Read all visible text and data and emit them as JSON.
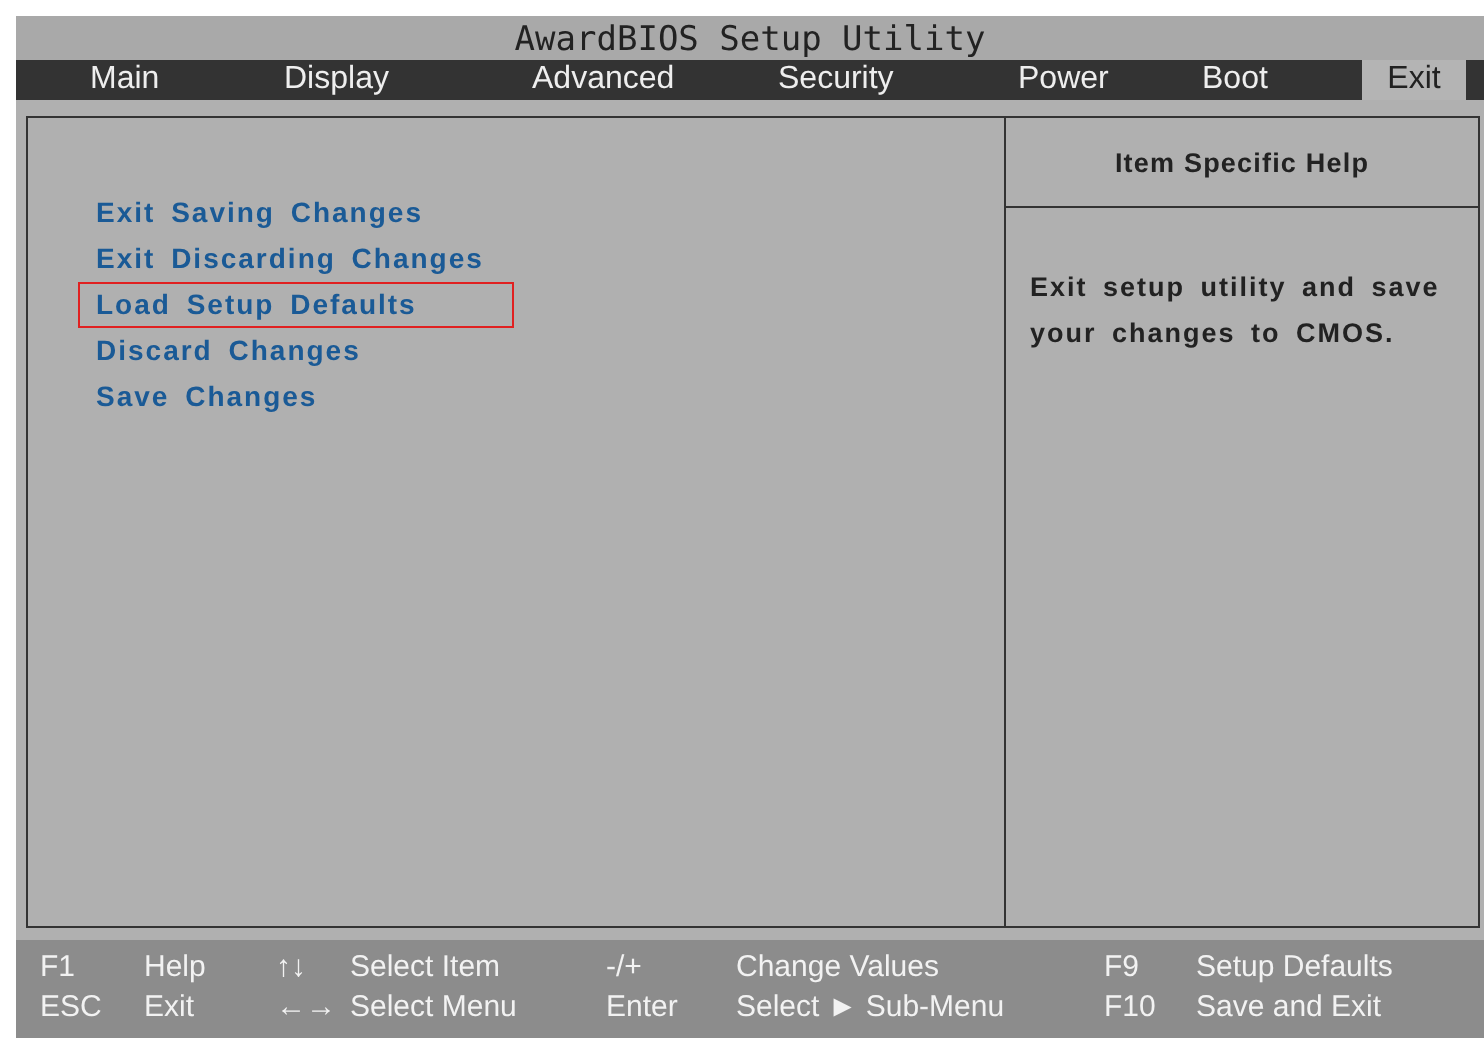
{
  "window": {
    "title": "AwardBIOS Setup Utility"
  },
  "tabs": [
    {
      "label": "Main",
      "selected": false
    },
    {
      "label": "Display",
      "selected": false
    },
    {
      "label": "Advanced",
      "selected": false
    },
    {
      "label": "Security",
      "selected": false
    },
    {
      "label": "Power",
      "selected": false
    },
    {
      "label": "Boot",
      "selected": false
    },
    {
      "label": "Exit",
      "selected": true
    }
  ],
  "menu": {
    "items": [
      {
        "label": "Exit Saving Changes",
        "selected": false
      },
      {
        "label": "Exit Discarding Changes",
        "selected": false
      },
      {
        "label": "Load Setup Defaults",
        "selected": true
      },
      {
        "label": "Discard Changes",
        "selected": false
      },
      {
        "label": "Save Changes",
        "selected": false
      }
    ]
  },
  "help": {
    "title": "Item Specific Help",
    "text": "Exit setup utility and save your changes to CMOS."
  },
  "status_bar": [
    [
      {
        "key": "F1",
        "action": "Help"
      },
      {
        "key": "↑↓",
        "action": "Select Item"
      },
      {
        "key": "-/+",
        "action": "Change Values"
      },
      {
        "key": "F9",
        "action": "Setup Defaults"
      }
    ],
    [
      {
        "key": "ESC",
        "action": "Exit"
      },
      {
        "key": "←→",
        "action": "Select Menu"
      },
      {
        "key": "Enter",
        "action": "Select ► Sub-Menu"
      },
      {
        "key": "F10",
        "action": "Save and Exit"
      }
    ]
  ]
}
